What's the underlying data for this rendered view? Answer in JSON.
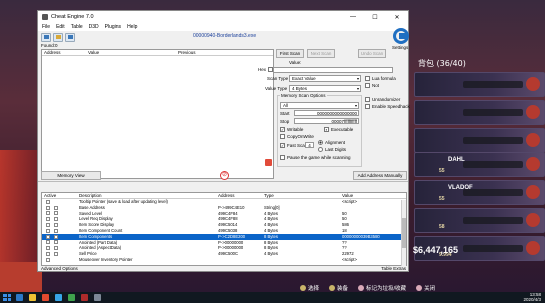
{
  "window": {
    "title": "Cheat Engine 7.0",
    "process": "00000940-Borderlands3.exe",
    "menu": [
      "File",
      "Edit",
      "Table",
      "D3D",
      "Plugins",
      "Help"
    ],
    "controls": {
      "minimize": "—",
      "maximize": "☐",
      "close": "✕"
    }
  },
  "found": "Found:0",
  "found_columns": [
    "Address",
    "Value",
    "Previous"
  ],
  "scan": {
    "first_scan": "First Scan",
    "next_scan": "Next Scan",
    "undo_scan": "Undo Scan",
    "value_label": "Value:",
    "hex": "Hex",
    "scan_type_label": "Scan Type",
    "scan_type": "Exact Value",
    "value_type_label": "Value Type",
    "value_type": "4 Bytes",
    "lua_formula": "Lua formula",
    "not": "Not",
    "memory_scan_options": "Memory Scan Options",
    "region": "All",
    "start_label": "Start",
    "start_value": "0000000000000000",
    "stop_label": "Stop",
    "stop_value": "00007fffffffffff",
    "writable": "Writable",
    "executable": "Executable",
    "copy_on_write": "CopyOnWrite",
    "fast_scan": "Fast Scan",
    "fast_scan_value": "4",
    "alignment": "Alignment",
    "last_digits": "Last Digits",
    "pause": "Pause the game while scanning",
    "unrandomizer": "Unrandomizer",
    "enable_speedhack": "Enable Speedhack",
    "settings": "Settings"
  },
  "actions": {
    "memory_view": "Memory View",
    "add_address": "Add Address Manually"
  },
  "table_columns": [
    "Active",
    "Description",
    "Address",
    "Type",
    "Value"
  ],
  "rows": [
    {
      "desc": "Tooltip Pointer (save & load after updating level)",
      "addr": "",
      "type": "",
      "value": "<script>",
      "sel": false
    },
    {
      "desc": "Base Address",
      "addr": "P->499C4E10",
      "type": "String[0]",
      "value": "",
      "sel": false
    },
    {
      "desc": "Saved Level",
      "addr": "499C4F84",
      "type": "4 Bytes",
      "value": "50",
      "sel": false
    },
    {
      "desc": "Level Req Display",
      "addr": "499C4F88",
      "type": "4 Bytes",
      "value": "50",
      "sel": false
    },
    {
      "desc": "Item Score Display",
      "addr": "499C5014",
      "type": "4 Bytes",
      "value": "586",
      "sel": false
    },
    {
      "desc": "Item Component Count",
      "addr": "499C5038",
      "type": "4 Bytes",
      "value": "18",
      "sel": false
    },
    {
      "desc": "Item Components",
      "addr": "P->C2D8E200",
      "type": "8 Bytes",
      "value": "00000000039B3580",
      "sel": true
    },
    {
      "desc": "Anointed (Part Data)",
      "addr": "P->00000000",
      "type": "8 Bytes",
      "value": "??",
      "sel": false
    },
    {
      "desc": "Anointed (AspectData)",
      "addr": "P->00000000",
      "type": "8 Bytes",
      "value": "??",
      "sel": false
    },
    {
      "desc": "Sell Price",
      "addr": "499C500C",
      "type": "4 Bytes",
      "value": "22972",
      "sel": false
    },
    {
      "desc": "Mouseover Inventory Pointer",
      "addr": "",
      "type": "",
      "value": "<script>",
      "sel": false
    }
  ],
  "advanced_options": "Advanced Options",
  "table_extras": "Table Extras",
  "game": {
    "inventory_title": "背包 (36/40)",
    "cards": [
      {
        "num": "",
        "brand": ""
      },
      {
        "num": "",
        "brand": ""
      },
      {
        "num": "",
        "brand": ""
      },
      {
        "num": "55",
        "brand": "DAHL"
      },
      {
        "num": "55",
        "brand": "VLADOF"
      },
      {
        "num": "58",
        "brand": ""
      },
      {
        "num": "9.994",
        "brand": ""
      }
    ],
    "money": "$6,447,165",
    "hud": [
      "选择",
      "装备",
      "标记为垃圾/收藏",
      "关闭"
    ]
  },
  "taskbar": {
    "time": "13:58",
    "date": "2020/4/3"
  }
}
